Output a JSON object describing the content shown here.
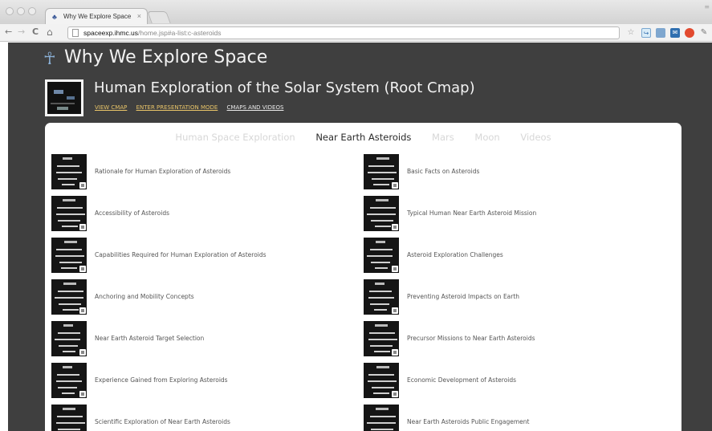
{
  "browser": {
    "tab_title": "Why We Explore Space",
    "tab_close": "×",
    "url_host": "spaceexp.ihmc.us",
    "url_path": "/home.jsp#a-list:c-asteroids"
  },
  "site": {
    "title": "Why We Explore Space",
    "logo_glyph": "☥"
  },
  "root_map": {
    "title": "Human Exploration of the Solar System (Root Cmap)",
    "links": [
      "VIEW CMAP",
      "ENTER PRESENTATION MODE",
      "CMAPS AND VIDEOS"
    ]
  },
  "tabs": [
    {
      "label": "Human Space Exploration",
      "active": false
    },
    {
      "label": "Near Earth Asteroids",
      "active": true
    },
    {
      "label": "Mars",
      "active": false
    },
    {
      "label": "Moon",
      "active": false
    },
    {
      "label": "Videos",
      "active": false
    }
  ],
  "items_left": [
    "Rationale for Human Exploration of Asteroids",
    "Accessibility of Asteroids",
    "Capabilities Required for Human Exploration of Asteroids",
    "Anchoring and Mobility Concepts",
    "Near Earth Asteroid Target Selection",
    "Experience Gained from Exploring Asteroids",
    "Scientific Exploration of Near Earth Asteroids"
  ],
  "items_right": [
    "Basic Facts on Asteroids",
    "Typical Human Near Earth Asteroid Mission",
    "Asteroid Exploration Challenges",
    "Preventing Asteroid Impacts on Earth",
    "Precursor Missions to Near Earth Asteroids",
    "Economic Development of Asteroids",
    "Near Earth Asteroids Public Engagement"
  ],
  "colors": {
    "page_bg": "#3f3f3f",
    "link_highlight": "#e8c468",
    "tab_inactive": "#d7d7d7",
    "tab_active": "#2b2b2b"
  },
  "icons": {
    "back": "←",
    "forward": "→",
    "reload": "C",
    "home": "⌂",
    "star": "☆",
    "wrench": "✎"
  }
}
